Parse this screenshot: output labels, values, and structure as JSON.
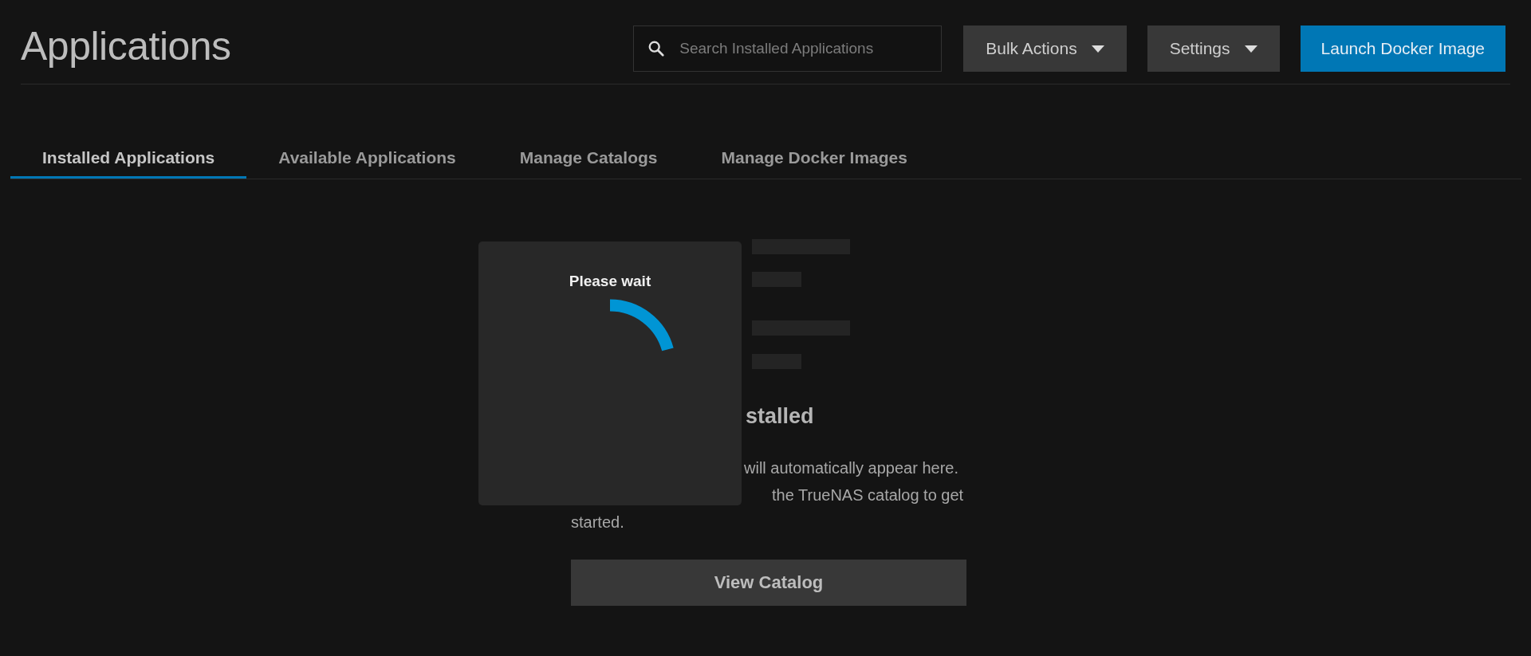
{
  "page": {
    "title": "Applications"
  },
  "search": {
    "placeholder": "Search Installed Applications"
  },
  "actions": [
    {
      "label": "Bulk Actions",
      "kind": "menu"
    },
    {
      "label": "Settings",
      "kind": "menu"
    },
    {
      "label": "Launch Docker Image",
      "kind": "primary"
    }
  ],
  "tabs": [
    {
      "label": "Installed Applications",
      "selected": true
    },
    {
      "label": "Available Applications",
      "selected": false
    },
    {
      "label": "Manage Catalogs",
      "selected": false
    },
    {
      "label": "Manage Docker Images",
      "selected": false
    }
  ],
  "empty_state": {
    "heading": "stalled",
    "lines": [
      "will automatically appear here.",
      "the TrueNAS catalog to get",
      "started."
    ],
    "button": "View Catalog"
  },
  "dialog": {
    "title": "Please wait"
  }
}
